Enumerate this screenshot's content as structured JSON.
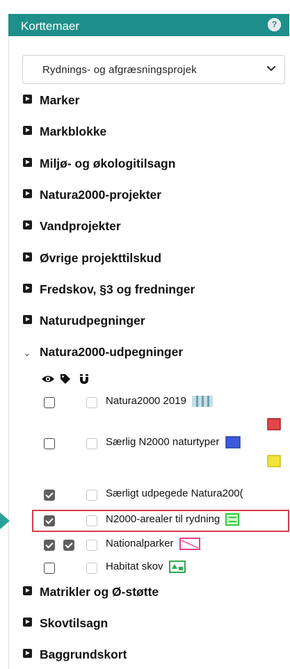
{
  "panel": {
    "title": "Korttemaer",
    "help_icon": "question-circle-icon",
    "help_label": "?",
    "accent": "#1f8f8b"
  },
  "dropdown": {
    "selected": "Rydnings- og afgræsningsprojek"
  },
  "groups_top": [
    "Marker",
    "Markblokke",
    "Miljø- og økologitilsagn",
    "Natura2000-projekter",
    "Vandprojekter",
    "Øvrige projekttilskud",
    "Fredskov, §3 og fredninger",
    "Naturudpegninger"
  ],
  "expanded_group": {
    "label": "Natura2000-udpegninger"
  },
  "column_icons": [
    "eye-icon",
    "tag-icon",
    "magnet-icon"
  ],
  "layers": [
    {
      "label": "Natura2000 2019",
      "visible": false,
      "labels": false
    },
    {
      "label": "Særlig N2000 naturtyper",
      "visible": false,
      "labels": false
    },
    {
      "label": "Særligt udpegede Natura200(",
      "visible": true,
      "labels": false
    },
    {
      "label": "N2000-arealer til rydning",
      "visible": true,
      "labels": false
    },
    {
      "label": "Nationalparker",
      "visible": true,
      "labels": true
    },
    {
      "label": "Habitat skov",
      "visible": false,
      "labels": false
    }
  ],
  "groups_bottom": [
    "Matrikler og Ø-støtte",
    "Skovtilsagn",
    "Baggrundskort"
  ],
  "colors": {
    "highlight": "#d63a4a",
    "pointer": "#2aa198",
    "red": "#e0454a",
    "blue": "#3b5bdb",
    "yellow": "#f0e33a",
    "green": "#2ecc40"
  }
}
